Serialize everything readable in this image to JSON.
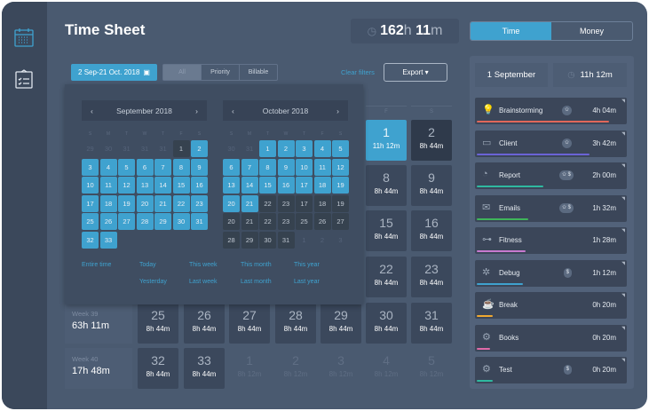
{
  "title": "Time Sheet",
  "total": {
    "hours": "162",
    "h": "h",
    "mins": "11",
    "m": "m"
  },
  "toggle": {
    "time": "Time",
    "money": "Money"
  },
  "filters": {
    "date_range": "2 Sep-21 Oct. 2018",
    "segments": [
      "All",
      "Priority",
      "Billable"
    ],
    "clear": "Clear filters",
    "export": "Export ▾"
  },
  "calendar": {
    "weekdays": [
      "S",
      "M",
      "T",
      "W",
      "T",
      "F",
      "S"
    ],
    "months": [
      {
        "title": "September 2018",
        "days": [
          [
            "29",
            "fade"
          ],
          [
            "30",
            "fade"
          ],
          [
            "31",
            "fade"
          ],
          [
            "31",
            "fade"
          ],
          [
            "31",
            "fade"
          ],
          [
            "1",
            "dark"
          ],
          [
            "2",
            "sel"
          ],
          [
            "3",
            "sel"
          ],
          [
            "4",
            "sel"
          ],
          [
            "5",
            "sel"
          ],
          [
            "6",
            "sel"
          ],
          [
            "7",
            "sel"
          ],
          [
            "8",
            "sel"
          ],
          [
            "9",
            "sel"
          ],
          [
            "10",
            "sel"
          ],
          [
            "11",
            "sel"
          ],
          [
            "12",
            "sel"
          ],
          [
            "13",
            "sel"
          ],
          [
            "14",
            "sel"
          ],
          [
            "15",
            "sel"
          ],
          [
            "16",
            "sel"
          ],
          [
            "17",
            "sel"
          ],
          [
            "18",
            "sel"
          ],
          [
            "19",
            "sel"
          ],
          [
            "20",
            "sel"
          ],
          [
            "21",
            "sel"
          ],
          [
            "22",
            "sel"
          ],
          [
            "23",
            "sel"
          ],
          [
            "25",
            "sel"
          ],
          [
            "26",
            "sel"
          ],
          [
            "27",
            "sel"
          ],
          [
            "28",
            "sel"
          ],
          [
            "29",
            "sel"
          ],
          [
            "30",
            "sel"
          ],
          [
            "31",
            "sel"
          ],
          [
            "32",
            "sel"
          ],
          [
            "33",
            "sel"
          ]
        ]
      },
      {
        "title": "October 2018",
        "days": [
          [
            "30",
            "fade"
          ],
          [
            "31",
            "fade"
          ],
          [
            "1",
            "sel"
          ],
          [
            "2",
            "sel"
          ],
          [
            "3",
            "sel"
          ],
          [
            "4",
            "sel"
          ],
          [
            "5",
            "sel"
          ],
          [
            "6",
            "sel"
          ],
          [
            "7",
            "sel"
          ],
          [
            "8",
            "sel"
          ],
          [
            "9",
            "sel"
          ],
          [
            "10",
            "sel"
          ],
          [
            "11",
            "sel"
          ],
          [
            "12",
            "sel"
          ],
          [
            "13",
            "sel"
          ],
          [
            "14",
            "sel"
          ],
          [
            "15",
            "sel"
          ],
          [
            "16",
            "sel"
          ],
          [
            "17",
            "sel"
          ],
          [
            "18",
            "sel"
          ],
          [
            "19",
            "sel"
          ],
          [
            "20",
            "sel"
          ],
          [
            "21",
            "sel"
          ],
          [
            "22",
            "dark"
          ],
          [
            "23",
            "dark"
          ],
          [
            "17",
            "dark"
          ],
          [
            "18",
            "dark"
          ],
          [
            "19",
            "dark"
          ],
          [
            "20",
            "dark"
          ],
          [
            "21",
            "dark"
          ],
          [
            "22",
            "dark"
          ],
          [
            "23",
            "dark"
          ],
          [
            "25",
            "dark"
          ],
          [
            "26",
            "dark"
          ],
          [
            "27",
            "dark"
          ],
          [
            "28",
            "dark"
          ],
          [
            "29",
            "dark"
          ],
          [
            "30",
            "dark"
          ],
          [
            "31",
            "dark"
          ],
          [
            "1",
            "fade"
          ],
          [
            "2",
            "fade"
          ],
          [
            "3",
            "fade"
          ]
        ]
      }
    ],
    "quick": [
      [
        "Entire time"
      ],
      [
        "Today",
        "Yesterday"
      ],
      [
        "This week",
        "Last week"
      ],
      [
        "This month",
        "Last month"
      ],
      [
        "This year",
        "Last year"
      ]
    ]
  },
  "grid": {
    "day_headers": [
      "F",
      "S"
    ],
    "rows": [
      {
        "cells": [
          null,
          null,
          null,
          null,
          null,
          [
            "1",
            "11h 12m",
            "act"
          ],
          [
            "2",
            "8h 44m",
            "dk"
          ]
        ]
      },
      {
        "cells": [
          null,
          null,
          null,
          null,
          null,
          [
            "8",
            "8h 44m",
            ""
          ],
          [
            "9",
            "8h 44m",
            ""
          ]
        ]
      },
      {
        "cells": [
          null,
          null,
          null,
          null,
          null,
          [
            "15",
            "8h 44m",
            ""
          ],
          [
            "16",
            "8h 44m",
            ""
          ]
        ]
      },
      {
        "cells": [
          null,
          null,
          null,
          null,
          null,
          [
            "22",
            "8h 44m",
            ""
          ],
          [
            "23",
            "8h 44m",
            ""
          ]
        ]
      },
      {
        "week": "Week 39",
        "total": "63h 11m",
        "cells": [
          [
            "25",
            "8h 44m",
            ""
          ],
          [
            "26",
            "8h 44m",
            ""
          ],
          [
            "27",
            "8h 44m",
            ""
          ],
          [
            "28",
            "8h 44m",
            ""
          ],
          [
            "29",
            "8h 44m",
            ""
          ],
          [
            "30",
            "8h 44m",
            ""
          ],
          [
            "31",
            "8h 44m",
            ""
          ]
        ]
      },
      {
        "week": "Week 40",
        "total": "17h 48m",
        "cells": [
          [
            "32",
            "8h 44m",
            ""
          ],
          [
            "33",
            "8h 44m",
            ""
          ],
          [
            "1",
            "8h 12m",
            "fu"
          ],
          [
            "2",
            "8h 12m",
            "fu"
          ],
          [
            "3",
            "8h 12m",
            "fu"
          ],
          [
            "4",
            "8h 12m",
            "fu"
          ],
          [
            "5",
            "8h 12m",
            "fu"
          ]
        ]
      }
    ]
  },
  "day_panel": {
    "date": "1 September",
    "total": "11h 12m",
    "items": [
      {
        "name": "Brainstorming",
        "icon": "lightbulb",
        "badge": "✩",
        "time": "4h 04m",
        "color": "#e0675a",
        "pct": 0.89
      },
      {
        "name": "Client",
        "icon": "monitor",
        "badge": "✩",
        "time": "3h 42m",
        "color": "#6a63d6",
        "pct": 0.76
      },
      {
        "name": "Report",
        "icon": "pie-chart",
        "badge": "✩ $",
        "time": "2h 00m",
        "color": "#2fb9a0",
        "pct": 0.45
      },
      {
        "name": "Emails",
        "icon": "envelope",
        "badge": "✩ $",
        "time": "1h 32m",
        "color": "#3fb55a",
        "pct": 0.35
      },
      {
        "name": "Fitness",
        "icon": "dumbbell",
        "badge": "",
        "time": "1h 28m",
        "color": "#c77ad0",
        "pct": 0.33
      },
      {
        "name": "Debug",
        "icon": "bug",
        "badge": "$",
        "time": "1h 12m",
        "color": "#3fa2cf",
        "pct": 0.31
      },
      {
        "name": "Break",
        "icon": "coffee",
        "badge": "",
        "time": "0h 20m",
        "color": "#f0a930",
        "pct": 0.11
      },
      {
        "name": "Books",
        "icon": "gear",
        "badge": "",
        "time": "0h 20m",
        "color": "#e06aa8",
        "pct": 0.09
      },
      {
        "name": "Test",
        "icon": "gear",
        "badge": "$",
        "time": "0h 20m",
        "color": "#2fb9a0",
        "pct": 0.11
      }
    ]
  }
}
